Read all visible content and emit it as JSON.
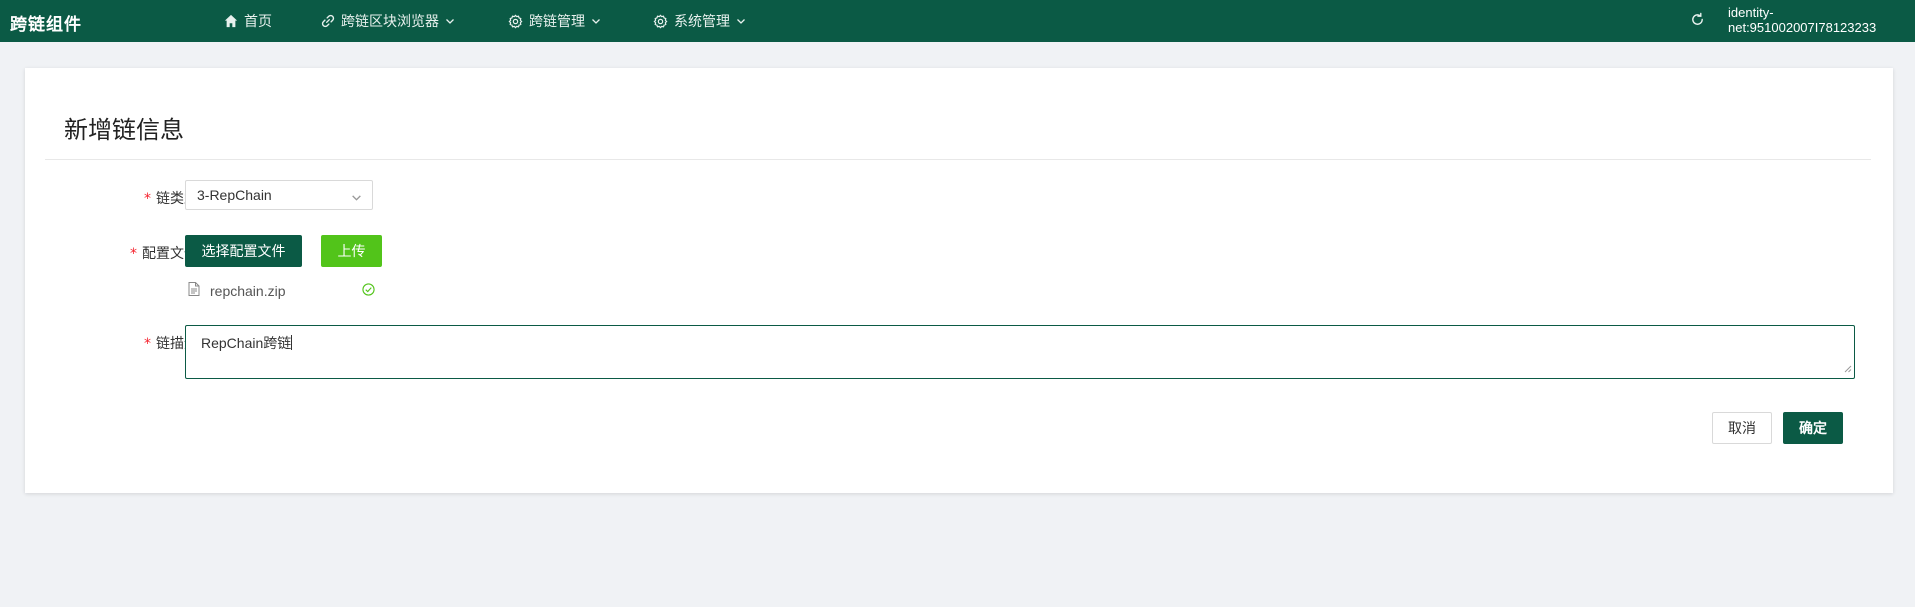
{
  "header": {
    "brand": "跨链组件",
    "nav": [
      {
        "label": "首页",
        "icon": "home-icon"
      },
      {
        "label": "跨链区块浏览器",
        "icon": "link-icon",
        "dropdown": true
      },
      {
        "label": "跨链管理",
        "icon": "gear-icon",
        "dropdown": true
      },
      {
        "label": "系统管理",
        "icon": "gear-icon",
        "dropdown": true
      }
    ],
    "identity_line1": "identity-",
    "identity_line2": "net:951002007I78123233"
  },
  "form": {
    "title": "新增链信息",
    "chain_type": {
      "label": "链类型",
      "value": "3-RepChain"
    },
    "config_file": {
      "label": "配置文件",
      "select_button": "选择配置文件",
      "upload_button": "上传",
      "file_name": "repchain.zip",
      "file_status": "success"
    },
    "description": {
      "label": "链描述",
      "value": "RepChain跨链"
    },
    "cancel_button": "取消",
    "confirm_button": "确定"
  },
  "colors": {
    "primary": "#0b5a45",
    "upload": "#52c41a",
    "required": "#f5222d",
    "success": "#52c41a"
  }
}
